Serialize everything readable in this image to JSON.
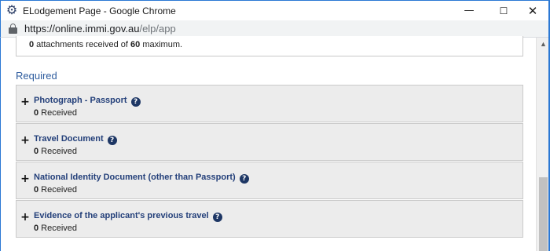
{
  "window": {
    "title": "ELodgement Page - Google Chrome",
    "app_icon": "gear-icon",
    "minimize": "—",
    "maximize": "☐",
    "close": "✕"
  },
  "address": {
    "url_host": "https://online.immi.gov.au",
    "url_path": "/elp/app"
  },
  "attachments": {
    "received": "0",
    "text_mid": " attachments received of ",
    "max": "60",
    "text_end": " maximum."
  },
  "section": {
    "title": "Required"
  },
  "documents": [
    {
      "title": "Photograph - Passport",
      "count": "0",
      "status": " Received"
    },
    {
      "title": "Travel Document",
      "count": "0",
      "status": " Received"
    },
    {
      "title": "National Identity Document (other than Passport)",
      "count": "0",
      "status": " Received"
    },
    {
      "title": "Evidence of the applicant's previous travel",
      "count": "0",
      "status": " Received"
    }
  ],
  "icons": {
    "expand": "+",
    "help": "?",
    "scroll_up": "▲"
  },
  "colors": {
    "accent": "#2b78d4",
    "doc_title": "#24407a",
    "section_title": "#2e5c9e",
    "help_badge": "#1d3664"
  }
}
